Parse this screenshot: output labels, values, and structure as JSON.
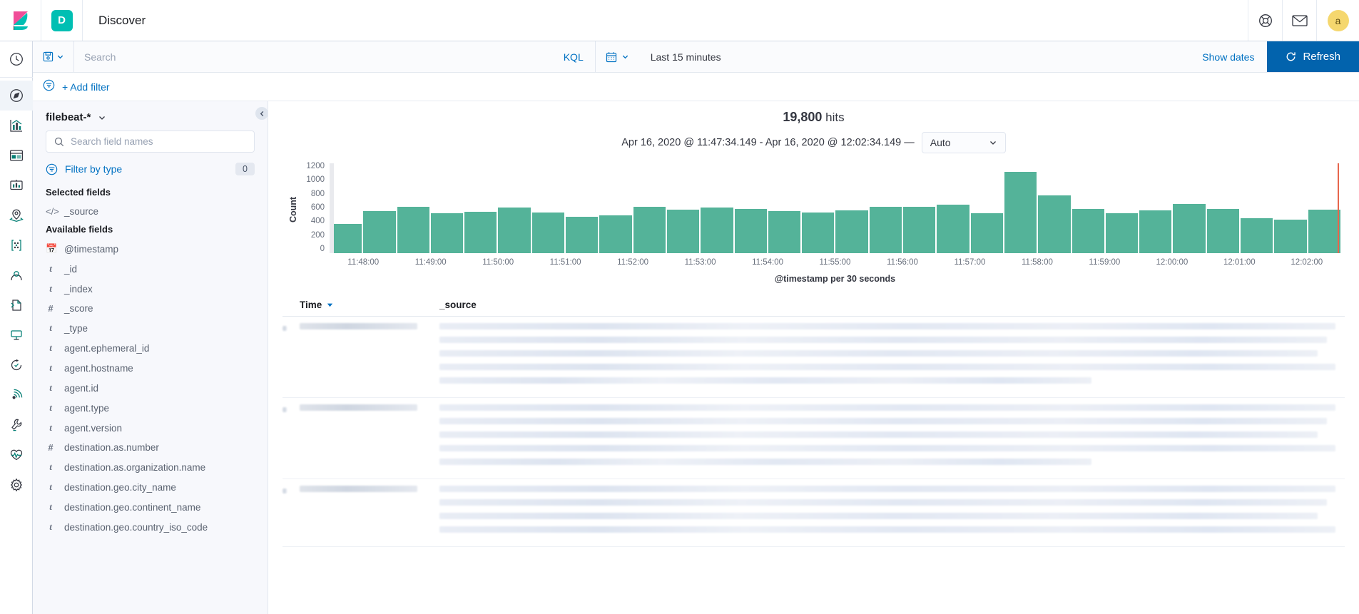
{
  "header": {
    "logo": "kibana-logo",
    "app_badge": "D",
    "app_title": "Discover",
    "icons": [
      "help-lifebuoy-icon",
      "mail-icon"
    ],
    "avatar_initial": "a"
  },
  "rail": {
    "items": [
      {
        "name": "recently-viewed",
        "icon": "clock-icon"
      },
      {
        "name": "discover",
        "icon": "compass-icon",
        "active": true
      },
      {
        "name": "visualize",
        "icon": "bar-chart-icon"
      },
      {
        "name": "dashboard",
        "icon": "dashboard-icon"
      },
      {
        "name": "canvas",
        "icon": "presentation-icon"
      },
      {
        "name": "maps",
        "icon": "map-marker-icon"
      },
      {
        "name": "machine-learning",
        "icon": "ml-nodes-icon"
      },
      {
        "name": "infrastructure",
        "icon": "user-profile-icon"
      },
      {
        "name": "logs",
        "icon": "logs-icon"
      },
      {
        "name": "metrics",
        "icon": "metrics-icon"
      },
      {
        "name": "apm",
        "icon": "apm-icon"
      },
      {
        "name": "uptime",
        "icon": "uptime-icon"
      },
      {
        "name": "dev-tools",
        "icon": "wrench-icon"
      },
      {
        "name": "monitoring",
        "icon": "heartbeat-icon"
      },
      {
        "name": "management",
        "icon": "gear-icon"
      }
    ]
  },
  "query_bar": {
    "saved_query_icon": "save-floppy-icon",
    "search_placeholder": "Search",
    "search_value": "",
    "language_label": "KQL",
    "calendar_icon": "calendar-icon",
    "date_range_label": "Last 15 minutes",
    "show_dates_label": "Show dates",
    "refresh_label": "Refresh",
    "refresh_icon": "refresh-icon",
    "refresh_color": "#0263ad"
  },
  "filter_bar": {
    "filter_icon": "filter-list-icon",
    "add_filter_label": "+ Add filter"
  },
  "sidebar": {
    "index_pattern": "filebeat-*",
    "index_pattern_chevron": "chevron-down-icon",
    "field_search_placeholder": "Search field names",
    "search_icon": "search-icon",
    "filter_by_type_label": "Filter by type",
    "filter_by_type_icon": "filter-list-icon",
    "filter_by_type_count": "0",
    "selected_fields_title": "Selected fields",
    "selected_fields": [
      {
        "name": "_source",
        "type": "source"
      }
    ],
    "available_fields_title": "Available fields",
    "available_fields": [
      {
        "name": "@timestamp",
        "type": "date"
      },
      {
        "name": "_id",
        "type": "string"
      },
      {
        "name": "_index",
        "type": "string"
      },
      {
        "name": "_score",
        "type": "number"
      },
      {
        "name": "_type",
        "type": "string"
      },
      {
        "name": "agent.ephemeral_id",
        "type": "string"
      },
      {
        "name": "agent.hostname",
        "type": "string"
      },
      {
        "name": "agent.id",
        "type": "string"
      },
      {
        "name": "agent.type",
        "type": "string"
      },
      {
        "name": "agent.version",
        "type": "string"
      },
      {
        "name": "destination.as.number",
        "type": "number"
      },
      {
        "name": "destination.as.organization.name",
        "type": "string"
      },
      {
        "name": "destination.geo.city_name",
        "type": "string"
      },
      {
        "name": "destination.geo.continent_name",
        "type": "string"
      },
      {
        "name": "destination.geo.country_iso_code",
        "type": "string"
      }
    ],
    "collapse_icon": "chevron-left-icon"
  },
  "main": {
    "hits_count": "19,800",
    "hits_label": "hits",
    "time_range_text": "Apr 16, 2020 @ 11:47:34.149 - Apr 16, 2020 @ 12:02:34.149 —",
    "interval_value": "Auto",
    "interval_chevron": "chevron-down-icon",
    "table": {
      "expand_col": "",
      "columns": [
        "Time",
        "_source"
      ],
      "sort_icon": "sort-down-icon",
      "rows": [
        {
          "time": "redacted",
          "source_lines": 5
        },
        {
          "time": "redacted",
          "source_lines": 5
        },
        {
          "time": "redacted",
          "source_lines": 4
        }
      ]
    }
  },
  "chart_data": {
    "type": "bar",
    "title": "",
    "xlabel": "@timestamp per 30 seconds",
    "ylabel": "Count",
    "ylim": [
      0,
      1300
    ],
    "yticks": [
      1200,
      1000,
      800,
      600,
      400,
      200,
      0
    ],
    "xticks": [
      "11:48:00",
      "11:49:00",
      "11:50:00",
      "11:51:00",
      "11:52:00",
      "11:53:00",
      "11:54:00",
      "11:55:00",
      "11:56:00",
      "11:57:00",
      "11:58:00",
      "11:59:00",
      "12:00:00",
      "12:01:00",
      "12:02:00"
    ],
    "bar_color": "#54B399",
    "now_marker_color": "#E7664C",
    "grid": false,
    "legend": "none",
    "values": [
      440,
      630,
      690,
      600,
      620,
      680,
      610,
      540,
      570,
      690,
      650,
      680,
      660,
      630,
      610,
      640,
      690,
      690,
      720,
      600,
      1210,
      860,
      660,
      600,
      640,
      740,
      660,
      520,
      500,
      650
    ]
  }
}
